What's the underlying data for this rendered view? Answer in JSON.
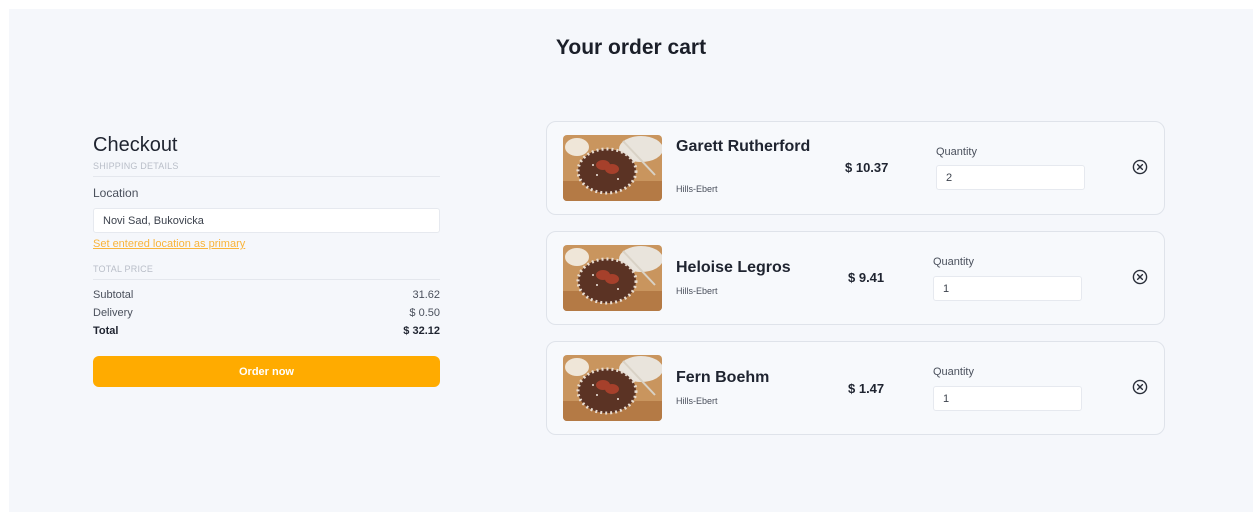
{
  "page": {
    "title": "Your order cart"
  },
  "checkout": {
    "title": "Checkout",
    "shipping_label": "SHIPPING DETAILS",
    "location_label": "Location",
    "location_value": "Novi Sad, Bukovicka",
    "primary_link": "Set entered location as primary",
    "total_price_label": "TOTAL PRICE",
    "subtotal_label": "Subtotal",
    "subtotal_value": "31.62",
    "delivery_label": "Delivery",
    "delivery_value": "$ 0.50",
    "total_label": "Total",
    "total_value": "$ 32.12",
    "order_button": "Order now"
  },
  "cart": {
    "items": [
      {
        "name": "Garett Rutherford",
        "vendor": "Hills-Ebert",
        "price": "$ 10.37",
        "quantity_label": "Quantity",
        "quantity": "2"
      },
      {
        "name": "Heloise Legros",
        "vendor": "Hills-Ebert",
        "price": "$ 9.41",
        "quantity_label": "Quantity",
        "quantity": "1"
      },
      {
        "name": "Fern Boehm",
        "vendor": "Hills-Ebert",
        "price": "$ 1.47",
        "quantity_label": "Quantity",
        "quantity": "1"
      }
    ]
  },
  "icons": {
    "remove": "close-circle-icon",
    "product": "cookie-image"
  },
  "colors": {
    "accent": "#ffab00",
    "link": "#f9b43a",
    "background": "#f5f7fb"
  }
}
